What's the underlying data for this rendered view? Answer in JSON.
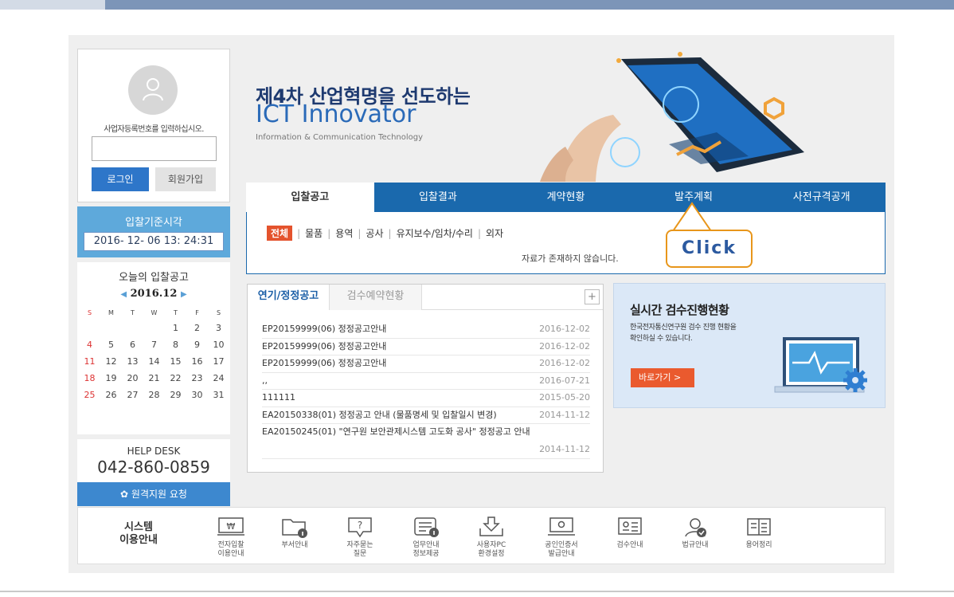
{
  "login": {
    "prompt": "사업자등록번호를 입력하십시오.",
    "input_value": "",
    "login_label": "로그인",
    "join_label": "회원가입"
  },
  "bid_time": {
    "label": "입찰기준시각",
    "value": "2016- 12- 06  13: 24:31"
  },
  "calendar": {
    "title": "오늘의 입찰공고",
    "month": "2016.12",
    "weekdays": [
      "S",
      "M",
      "T",
      "W",
      "T",
      "F",
      "S"
    ],
    "weeks": [
      [
        "",
        "",
        "",
        "",
        "1",
        "2",
        "3"
      ],
      [
        "4",
        "5",
        "6",
        "7",
        "8",
        "9",
        "10"
      ],
      [
        "11",
        "12",
        "13",
        "14",
        "15",
        "16",
        "17"
      ],
      [
        "18",
        "19",
        "20",
        "21",
        "22",
        "23",
        "24"
      ],
      [
        "25",
        "26",
        "27",
        "28",
        "29",
        "30",
        "31"
      ]
    ]
  },
  "helpdesk": {
    "title": "HELP DESK",
    "phone": "042-860-0859",
    "remote_label": "원격지원 요청"
  },
  "banner": {
    "title": "제4차 산업혁명을 선도하는",
    "subtitle": "ICT Innovator",
    "desc": "Information & Communication Technology"
  },
  "nav": {
    "tabs": [
      "입찰공고",
      "입찰결과",
      "계약현황",
      "발주계획",
      "사전규격공개"
    ],
    "subtabs": [
      "전체",
      "물품",
      "용역",
      "공사",
      "유지보수/임차/수리",
      "외자"
    ],
    "empty_message": "자료가 존재하지 않습니다."
  },
  "callout": {
    "text": "Click"
  },
  "notices": {
    "tab_active": "연기/정정공고",
    "tab_inactive": "검수예약현황",
    "more_label": "+",
    "rows": [
      {
        "title": "EP20159999(06) 정정공고안내",
        "date": "2016-12-02"
      },
      {
        "title": "EP20159999(06) 정정공고안내",
        "date": "2016-12-02"
      },
      {
        "title": "EP20159999(06) 정정공고안내",
        "date": "2016-12-02"
      },
      {
        "title": ",,",
        "date": "2016-07-21"
      },
      {
        "title": "111111",
        "date": "2015-05-20"
      },
      {
        "title": "EA20150338(01) 정정공고 안내 (물품명세 및 입찰일시 변경)",
        "date": "2014-11-12"
      },
      {
        "title": "EA20150245(01) \"연구원 보안관제시스템 고도화 공사\" 정정공고 안내",
        "date": "2014-11-12"
      }
    ]
  },
  "inspection": {
    "title": "실시간 검수진행현황",
    "desc_line1": "한국전자통신연구원 검수 진행 현황을",
    "desc_line2": "확인하실 수 있습니다.",
    "button_label": "바로가기 >"
  },
  "guide": {
    "title_line1": "시스템",
    "title_line2": "이용안내",
    "items": [
      {
        "l1": "전자입찰",
        "l2": "이용안내",
        "icon": "won-icon"
      },
      {
        "l1": "부서안내",
        "l2": "",
        "icon": "folder-info-icon"
      },
      {
        "l1": "자주묻는",
        "l2": "질문",
        "icon": "question-icon"
      },
      {
        "l1": "업무안내",
        "l2": "정보제공",
        "icon": "list-info-icon"
      },
      {
        "l1": "사용자PC",
        "l2": "환경설정",
        "icon": "download-icon"
      },
      {
        "l1": "공인인증서",
        "l2": "발급안내",
        "icon": "monitor-cert-icon"
      },
      {
        "l1": "검수안내",
        "l2": "",
        "icon": "inspection-icon"
      },
      {
        "l1": "법규안내",
        "l2": "",
        "icon": "law-icon"
      },
      {
        "l1": "용어정리",
        "l2": "",
        "icon": "glossary-icon"
      }
    ]
  }
}
